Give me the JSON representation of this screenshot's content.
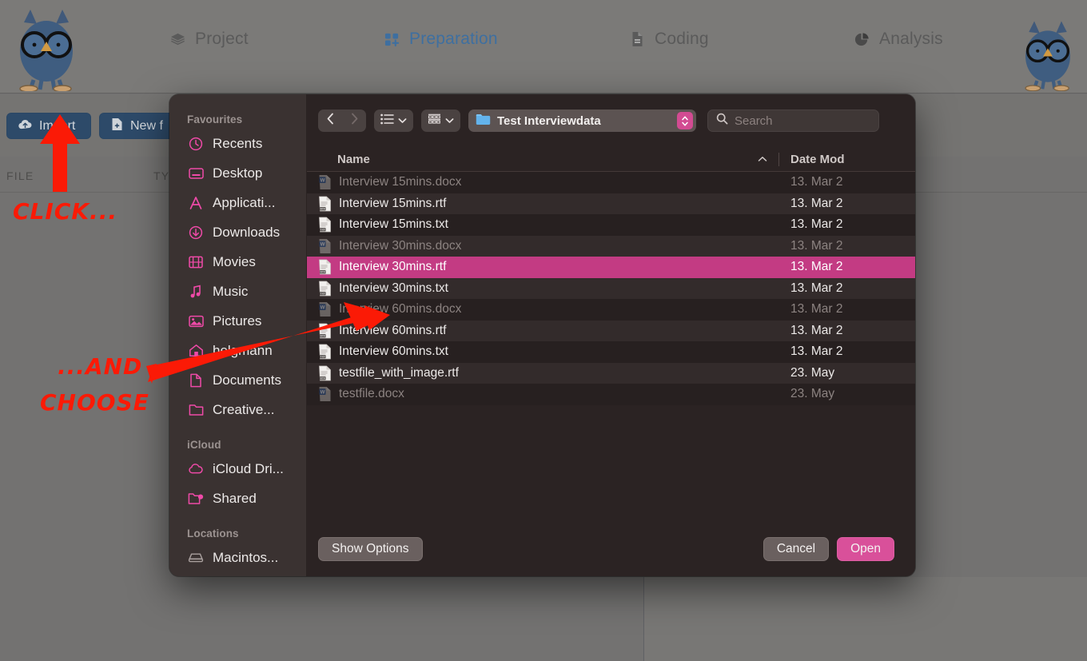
{
  "app": {
    "nav": [
      {
        "label": "Project",
        "icon": "layers-icon",
        "active": false
      },
      {
        "label": "Preparation",
        "icon": "grid-plus-icon",
        "active": true
      },
      {
        "label": "Coding",
        "icon": "document-icon",
        "active": false
      },
      {
        "label": "Analysis",
        "icon": "pie-chart-icon",
        "active": false
      }
    ],
    "toolbar": {
      "import_label": "Import",
      "import_icon": "cloud-upload-icon",
      "new_file_label": "New f",
      "new_file_icon": "new-document-icon"
    },
    "columns": {
      "file": "FILE",
      "type": "TY"
    },
    "logo_name": "owl-logo"
  },
  "annotations": {
    "click": "CLICK...",
    "and": "...AND",
    "choose": "CHOOSE",
    "color": "#fb1a06"
  },
  "dialog": {
    "sidebar": [
      {
        "type": "group",
        "label": "Favourites"
      },
      {
        "type": "item",
        "label": "Recents",
        "icon": "clock-icon"
      },
      {
        "type": "item",
        "label": "Desktop",
        "icon": "desktop-icon"
      },
      {
        "type": "item",
        "label": "Applicati...",
        "icon": "applications-icon"
      },
      {
        "type": "item",
        "label": "Downloads",
        "icon": "download-icon"
      },
      {
        "type": "item",
        "label": "Movies",
        "icon": "film-icon"
      },
      {
        "type": "item",
        "label": "Music",
        "icon": "music-note-icon"
      },
      {
        "type": "item",
        "label": "Pictures",
        "icon": "pictures-icon"
      },
      {
        "type": "item",
        "label": "helgmann",
        "icon": "home-icon"
      },
      {
        "type": "item",
        "label": "Documents",
        "icon": "document-icon"
      },
      {
        "type": "item",
        "label": "Creative...",
        "icon": "folder-icon"
      },
      {
        "type": "group",
        "label": "iCloud"
      },
      {
        "type": "item",
        "label": "iCloud Dri...",
        "icon": "cloud-icon"
      },
      {
        "type": "item",
        "label": "Shared",
        "icon": "shared-folder-icon"
      },
      {
        "type": "group",
        "label": "Locations"
      },
      {
        "type": "item",
        "label": "Macintos...",
        "icon": "hard-drive-icon"
      }
    ],
    "toolbar": {
      "back_icon": "chevron-left-icon",
      "forward_icon": "chevron-right-icon",
      "view_list_icon": "list-view-icon",
      "view_list_chevron": "chevron-down-icon",
      "group_icon": "icon-view-icon",
      "group_chevron": "chevron-down-icon",
      "path_label": "Test Interviewdata",
      "path_folder_icon": "folder-blue-icon",
      "path_stepper_icon": "updown-stepper-icon",
      "search_icon": "search-icon",
      "search_placeholder": "Search",
      "search_value": ""
    },
    "list": {
      "columns": {
        "name": "Name",
        "date_modified": "Date Mod"
      },
      "sort_indicator": "chevron-up-icon",
      "rows": [
        {
          "name": "Interview 15mins.docx",
          "date": "13. Mar 2",
          "icon": "word-doc-icon",
          "disabled": true,
          "selected": false
        },
        {
          "name": "Interview 15mins.rtf",
          "date": "13. Mar 2",
          "icon": "rtf-file-icon",
          "disabled": false,
          "selected": false
        },
        {
          "name": "Interview 15mins.txt",
          "date": "13. Mar 2",
          "icon": "txt-file-icon",
          "disabled": false,
          "selected": false
        },
        {
          "name": "Interview 30mins.docx",
          "date": "13. Mar 2",
          "icon": "word-doc-icon",
          "disabled": true,
          "selected": false
        },
        {
          "name": "Interview 30mins.rtf",
          "date": "13. Mar 2",
          "icon": "rtf-file-icon",
          "disabled": false,
          "selected": true
        },
        {
          "name": "Interview 30mins.txt",
          "date": "13. Mar 2",
          "icon": "txt-file-icon",
          "disabled": false,
          "selected": false
        },
        {
          "name": "Interview 60mins.docx",
          "date": "13. Mar 2",
          "icon": "word-doc-icon",
          "disabled": true,
          "selected": false
        },
        {
          "name": "Interview 60mins.rtf",
          "date": "13. Mar 2",
          "icon": "rtf-file-icon",
          "disabled": false,
          "selected": false
        },
        {
          "name": "Interview 60mins.txt",
          "date": "13. Mar 2",
          "icon": "txt-file-icon",
          "disabled": false,
          "selected": false
        },
        {
          "name": "testfile_with_image.rtf",
          "date": "23. May ",
          "icon": "rtf-file-icon",
          "disabled": false,
          "selected": false
        },
        {
          "name": "testfile.docx",
          "date": "23. May ",
          "icon": "word-doc-icon",
          "disabled": true,
          "selected": false
        }
      ]
    },
    "footer": {
      "show_options": "Show Options",
      "cancel": "Cancel",
      "open": "Open"
    },
    "colors": {
      "accent_pink": "#d9509a",
      "selection": "#c33b83",
      "sidebar_icon": "#ef4aa8",
      "panel_bg": "#2b2323",
      "sidebar_bg": "#3a3231"
    }
  }
}
